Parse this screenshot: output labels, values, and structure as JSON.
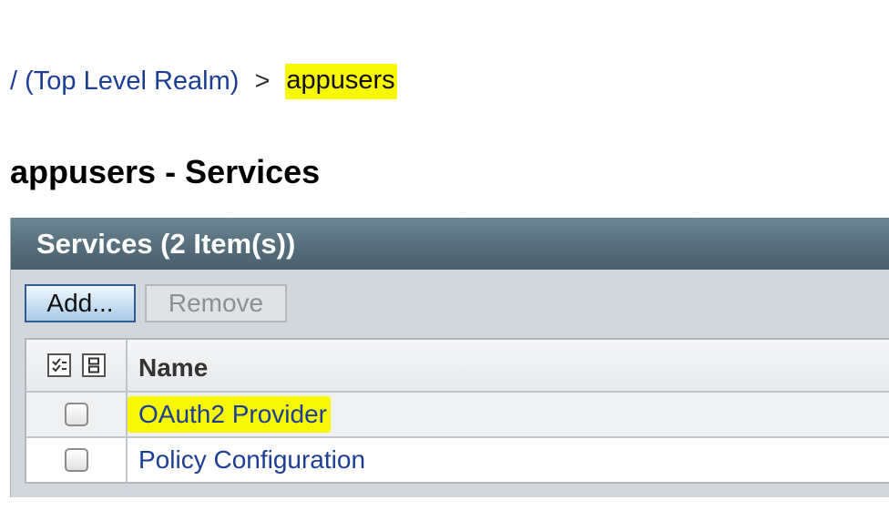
{
  "breadcrumb": {
    "root": "/ (Top Level Realm)",
    "separator": ">",
    "current": "appusers"
  },
  "page": {
    "title": "appusers - Services"
  },
  "services_panel": {
    "header": "Services (2 Item(s))",
    "add_label": "Add...",
    "remove_label": "Remove",
    "select_all_icon": "select-all-icon",
    "deselect_all_icon": "deselect-all-icon",
    "column_name": "Name",
    "rows": [
      {
        "name": "OAuth2 Provider",
        "checked": false,
        "highlighted": true
      },
      {
        "name": "Policy Configuration",
        "checked": false,
        "highlighted": false
      }
    ]
  },
  "colors": {
    "link": "#1c3f95",
    "highlight": "#f8f805",
    "panel_header": "#566d7b"
  }
}
